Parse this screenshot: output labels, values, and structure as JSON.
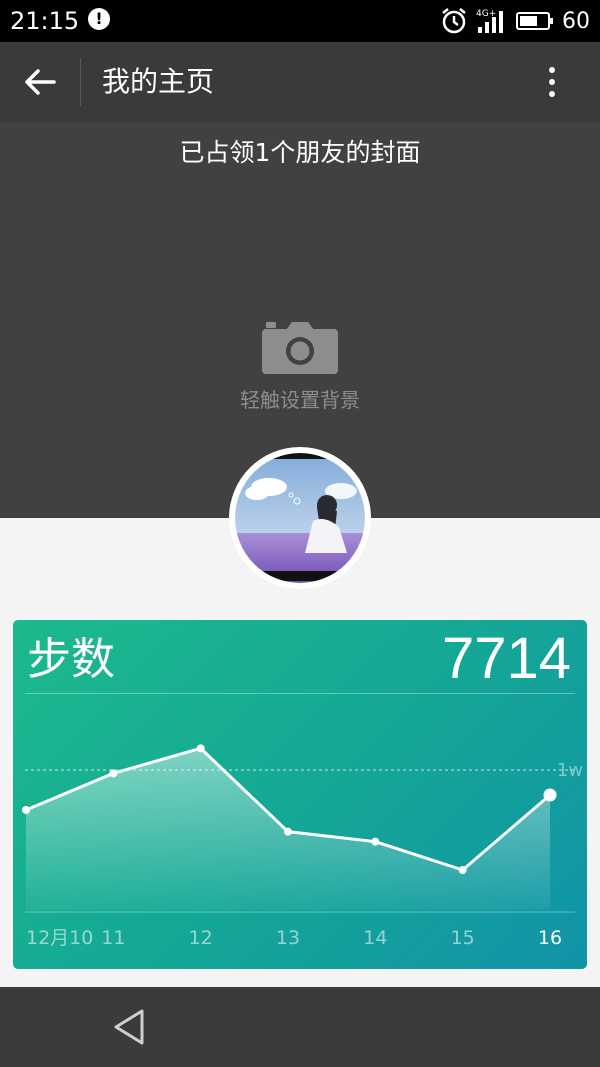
{
  "status_bar": {
    "time": "21:15",
    "network": "4G+",
    "battery": "60"
  },
  "app_bar": {
    "title": "我的主页"
  },
  "cover": {
    "caption": "已占领1个朋友的封面",
    "hint": "轻触设置背景"
  },
  "card": {
    "title": "步数",
    "value": "7714",
    "goal_label": "1w",
    "chart_data": {
      "type": "area",
      "categories": [
        "12月10",
        "11",
        "12",
        "13",
        "14",
        "15",
        "16"
      ],
      "values": [
        6000,
        8200,
        9700,
        4700,
        4100,
        2400,
        6900
      ],
      "goal": 8400,
      "ylim": [
        0,
        12000
      ],
      "highlight_index": 6,
      "line_color": "#ffffff"
    }
  },
  "icons": [
    "alert-icon",
    "alarm-icon",
    "signal-icon",
    "battery-icon",
    "back-arrow-icon",
    "more-vert-icon",
    "camera-icon",
    "nav-back-icon"
  ],
  "colors": {
    "card_start": "#1db98d",
    "card_end": "#1293a8",
    "cover_bg": "#414141",
    "appbar_bg": "#3a3a3a"
  }
}
